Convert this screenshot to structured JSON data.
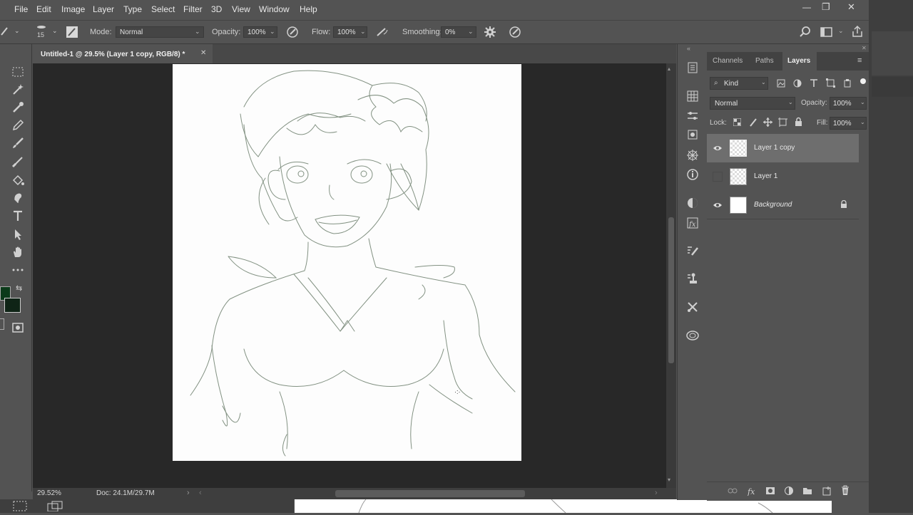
{
  "menu": [
    "File",
    "Edit",
    "Image",
    "Layer",
    "Type",
    "Select",
    "Filter",
    "3D",
    "View",
    "Window",
    "Help"
  ],
  "window_controls": {
    "minimize": "—",
    "restore": "❐",
    "close": "✕"
  },
  "options": {
    "brush_size": "15",
    "mode_label": "Mode:",
    "mode_value": "Normal",
    "opacity_label": "Opacity:",
    "opacity_value": "100%",
    "flow_label": "Flow:",
    "flow_value": "100%",
    "smoothing_label": "Smoothing:",
    "smoothing_value": "0%"
  },
  "document": {
    "tab_title": "Untitled-1 @ 29.5% (Layer 1 copy, RGB/8) *",
    "close": "✕",
    "zoom": "29.52%",
    "doc_size": "Doc: 24.1M/29.7M",
    "arrow": "›",
    "left_arrow": "‹",
    "right_arrow": "›"
  },
  "colors": {
    "foreground": "#0b3a1a",
    "background": "#0f2416",
    "accent": "#323232"
  },
  "panel": {
    "tabs": [
      "Channels",
      "Paths",
      "Layers"
    ],
    "active_tab": "Layers",
    "filter_kind": "Kind",
    "blend_mode": "Normal",
    "opacity_label": "Opacity:",
    "opacity_value": "100%",
    "lock_label": "Lock:",
    "fill_label": "Fill:",
    "fill_value": "100%",
    "layers": [
      {
        "name": "Layer 1 copy",
        "visible": true,
        "selected": true
      },
      {
        "name": "Layer 1",
        "visible": false,
        "selected": false
      },
      {
        "name": "Background",
        "visible": true,
        "selected": false,
        "locked": true
      }
    ]
  }
}
